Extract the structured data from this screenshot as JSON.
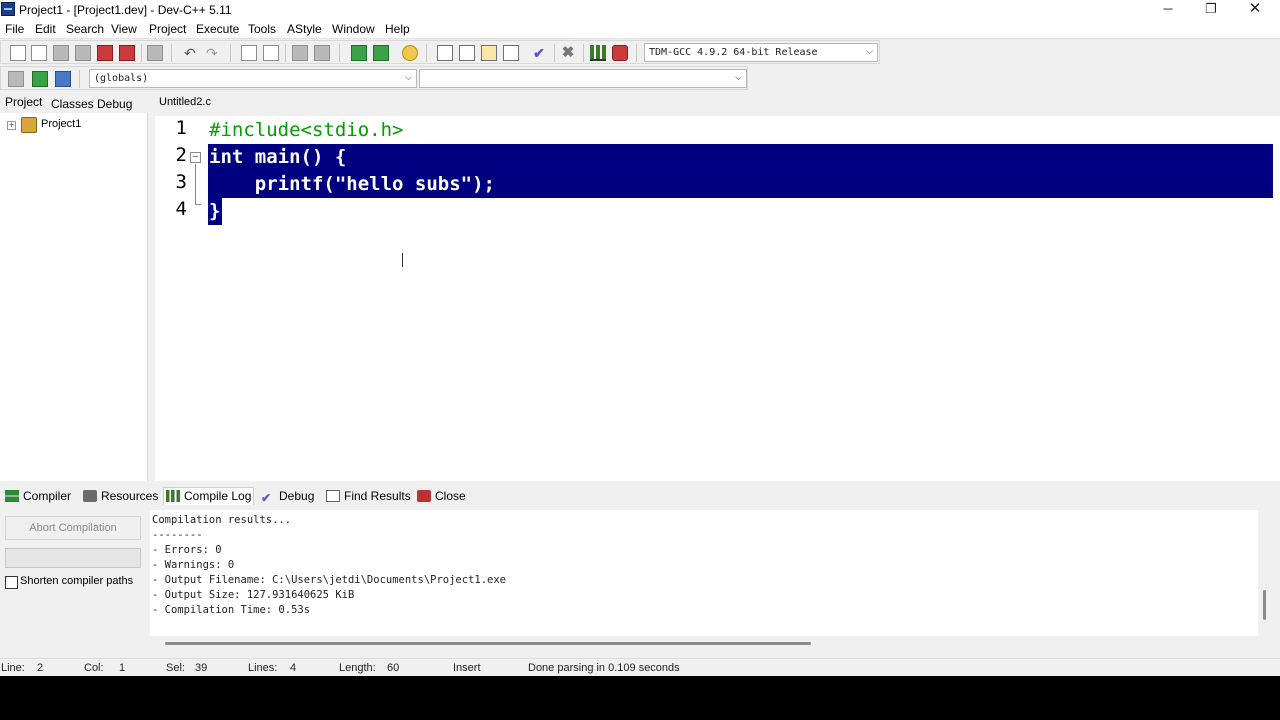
{
  "window": {
    "title": "Project1 - [Project1.dev] - Dev-C++ 5.11",
    "minimize_glyph": "─",
    "maximize_glyph": "❐",
    "close_glyph": "✕"
  },
  "menu": [
    "File",
    "Edit",
    "Search",
    "View",
    "Project",
    "Execute",
    "Tools",
    "AStyle",
    "Window",
    "Help"
  ],
  "toolbar": {
    "compiler_select": "TDM-GCC 4.9.2 64-bit Release",
    "scope_select": "(globals)",
    "function_select": ""
  },
  "left_panel": {
    "tabs": [
      "Project",
      "Classes",
      "Debug"
    ],
    "tree": [
      {
        "label": "Project1",
        "expander": "+"
      }
    ]
  },
  "editor": {
    "tab": "Untitled2.c",
    "lines": [
      {
        "num": "1",
        "text": "#include<stdio.h>"
      },
      {
        "num": "2",
        "text": "int main() {"
      },
      {
        "num": "3",
        "text": "    printf(\"hello subs\");"
      },
      {
        "num": "4",
        "text": "}"
      }
    ],
    "fold_glyph": "−",
    "colors": {
      "selection": "#000080",
      "preprocessor": "#00a000"
    }
  },
  "bottom_tabs": [
    "Compiler",
    "Resources",
    "Compile Log",
    "Debug",
    "Find Results",
    "Close"
  ],
  "bottom_panel": {
    "abort_label": "Abort Compilation",
    "shorten_label": "Shorten compiler paths",
    "log": [
      "Compilation results...",
      "--------",
      "- Errors: 0",
      "- Warnings: 0",
      "- Output Filename: C:\\Users\\jetdi\\Documents\\Project1.exe",
      "- Output Size: 127.931640625 KiB",
      "- Compilation Time: 0.53s"
    ]
  },
  "status": {
    "line_label": "Line:",
    "line_val": "2",
    "col_label": "Col:",
    "col_val": "1",
    "sel_label": "Sel:",
    "sel_val": "39",
    "lines_label": "Lines:",
    "lines_val": "4",
    "length_label": "Length:",
    "length_val": "60",
    "mode": "Insert",
    "message": "Done parsing in 0.109 seconds"
  }
}
